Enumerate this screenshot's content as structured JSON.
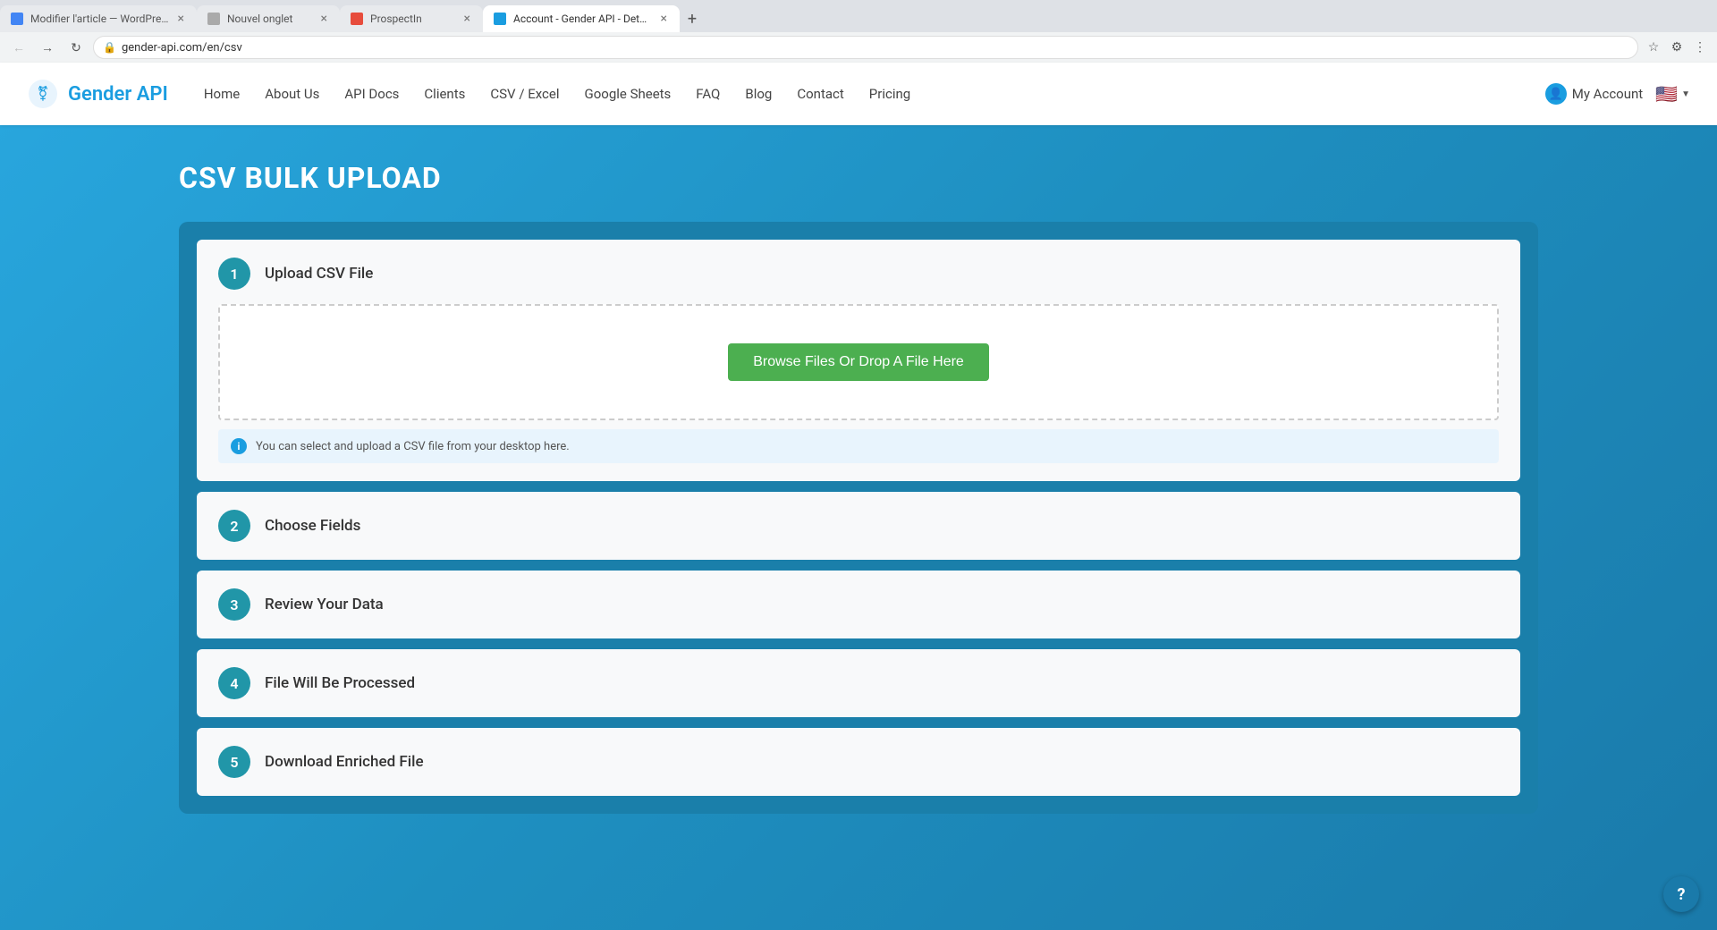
{
  "browser": {
    "tabs": [
      {
        "id": "tab1",
        "title": "Modifier l'article — WordPress",
        "active": false,
        "favicon_color": "#4285f4"
      },
      {
        "id": "tab2",
        "title": "Nouvel onglet",
        "active": false,
        "favicon_color": "#aaa"
      },
      {
        "id": "tab3",
        "title": "ProspectIn",
        "active": false,
        "favicon_color": "#e74c3c"
      },
      {
        "id": "tab4",
        "title": "Account - Gender API - Determ...",
        "active": true,
        "favicon_color": "#1a9de0"
      }
    ],
    "address": "gender-api.com/en/csv"
  },
  "navbar": {
    "logo_text": "Gender API",
    "links": [
      {
        "label": "Home"
      },
      {
        "label": "About Us"
      },
      {
        "label": "API Docs"
      },
      {
        "label": "Clients"
      },
      {
        "label": "CSV / Excel"
      },
      {
        "label": "Google Sheets"
      },
      {
        "label": "FAQ"
      },
      {
        "label": "Blog"
      },
      {
        "label": "Contact"
      },
      {
        "label": "Pricing"
      }
    ],
    "my_account": "My Account",
    "flag_emoji": "🇺🇸"
  },
  "page": {
    "title": "CSV BULK UPLOAD"
  },
  "steps": [
    {
      "number": "1",
      "title": "Upload CSV File",
      "has_upload": true,
      "upload_btn_label": "Browse Files Or Drop A File Here",
      "upload_info": "You can select and upload a CSV file from your desktop here."
    },
    {
      "number": "2",
      "title": "Choose Fields"
    },
    {
      "number": "3",
      "title": "Review Your Data"
    },
    {
      "number": "4",
      "title": "File Will Be Processed"
    },
    {
      "number": "5",
      "title": "Download Enriched File"
    }
  ],
  "help_label": "?"
}
